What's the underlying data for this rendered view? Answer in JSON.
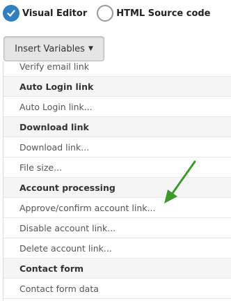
{
  "editor_mode": {
    "visual_label": "Visual Editor",
    "html_label": "HTML Source code",
    "selected": "visual"
  },
  "insert_variables": {
    "button_label": "Insert Variables",
    "menu": [
      {
        "type": "item",
        "label": "Verify email link"
      },
      {
        "type": "header",
        "label": "Auto Login link"
      },
      {
        "type": "item",
        "label": "Auto Login link..."
      },
      {
        "type": "header",
        "label": "Download link"
      },
      {
        "type": "item",
        "label": "Download link..."
      },
      {
        "type": "item",
        "label": "File size..."
      },
      {
        "type": "header",
        "label": "Account processing"
      },
      {
        "type": "item",
        "label": "Approve/confirm account link..."
      },
      {
        "type": "item",
        "label": "Disable account link..."
      },
      {
        "type": "item",
        "label": "Delete account link..."
      },
      {
        "type": "header",
        "label": "Contact form"
      },
      {
        "type": "item",
        "label": "Contact form data"
      }
    ]
  },
  "colors": {
    "accent": "#2f7fc1",
    "annotation_arrow": "#3a9a2a"
  },
  "icons": {
    "checked_radio": "check-icon",
    "dropdown_caret": "caret-down-icon",
    "annotation": "green-arrow-icon"
  }
}
